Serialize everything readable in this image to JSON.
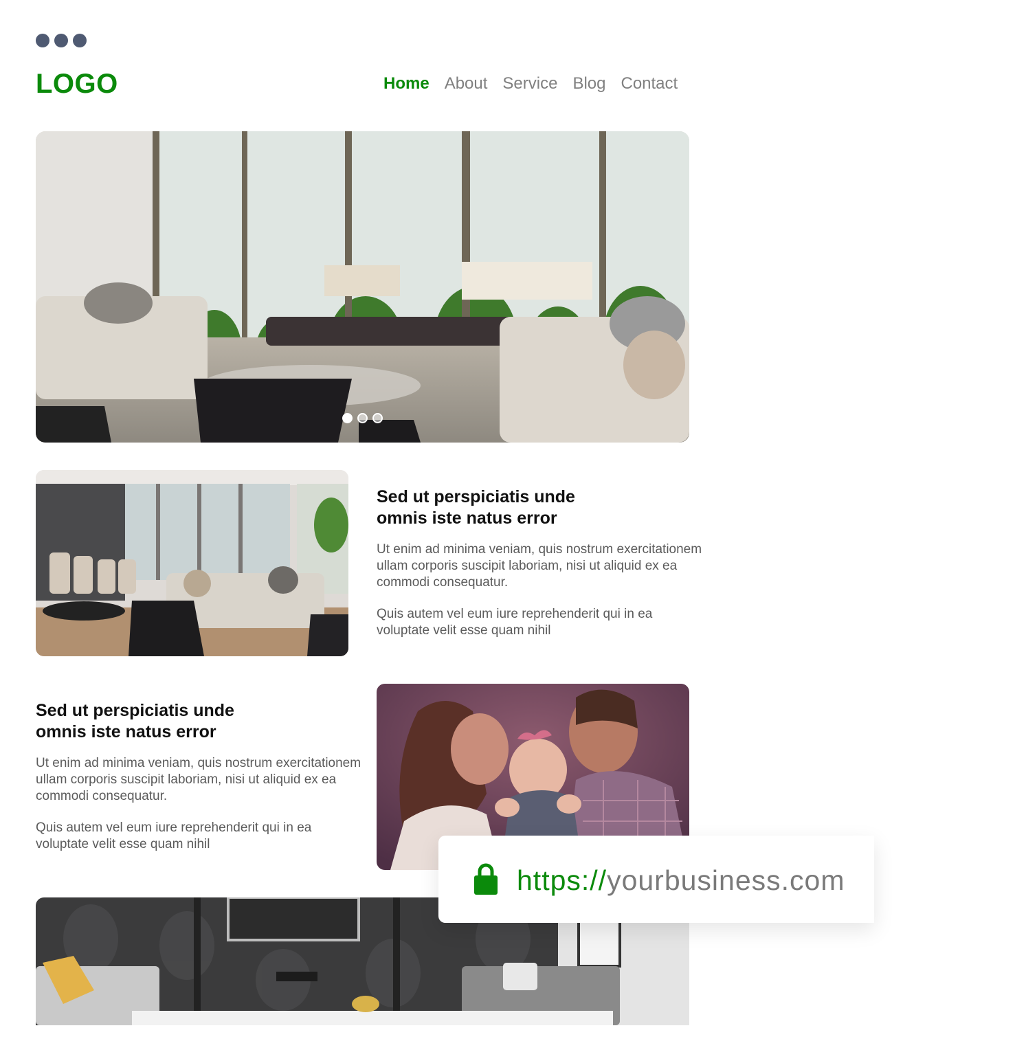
{
  "header": {
    "logo": "LOGO",
    "nav": [
      {
        "label": "Home",
        "active": true
      },
      {
        "label": "About",
        "active": false
      },
      {
        "label": "Service",
        "active": false
      },
      {
        "label": "Blog",
        "active": false
      },
      {
        "label": "Contact",
        "active": false
      }
    ]
  },
  "hero": {
    "image": "living-room-with-glass-doors-and-patio",
    "slides_total": 3,
    "active_slide": 1
  },
  "sections": [
    {
      "image": "living-room-with-dining-area",
      "title_line1": "Sed ut perspiciatis unde",
      "title_line2": "omnis iste natus error",
      "paragraph1": "Ut enim ad minima veniam, quis nostrum exercitationem ullam corporis suscipit laboriam, nisi ut aliquid ex ea commodi consequatur.",
      "paragraph2": "Quis autem vel eum iure reprehenderit qui in ea voluptate velit esse quam nihil"
    },
    {
      "image": "family-kissing-baby",
      "title_line1": "Sed ut perspiciatis unde",
      "title_line2": "omnis iste natus error",
      "paragraph1": "Ut enim ad minima veniam, quis nostrum exercitationem ullam corporis suscipit laboriam, nisi ut aliquid ex ea commodi consequatur.",
      "paragraph2": "Quis autem vel eum iure reprehenderit qui in ea voluptate velit esse quam nihil"
    }
  ],
  "bottom_image": "living-room-with-tv-and-damask-wall",
  "url_bar": {
    "protocol": "https://",
    "domain": "yourbusiness.com",
    "icon": "lock-icon"
  },
  "colors": {
    "brand_green": "#0b8a0b",
    "nav_gray": "#808080",
    "window_dot": "#4f5a72"
  }
}
